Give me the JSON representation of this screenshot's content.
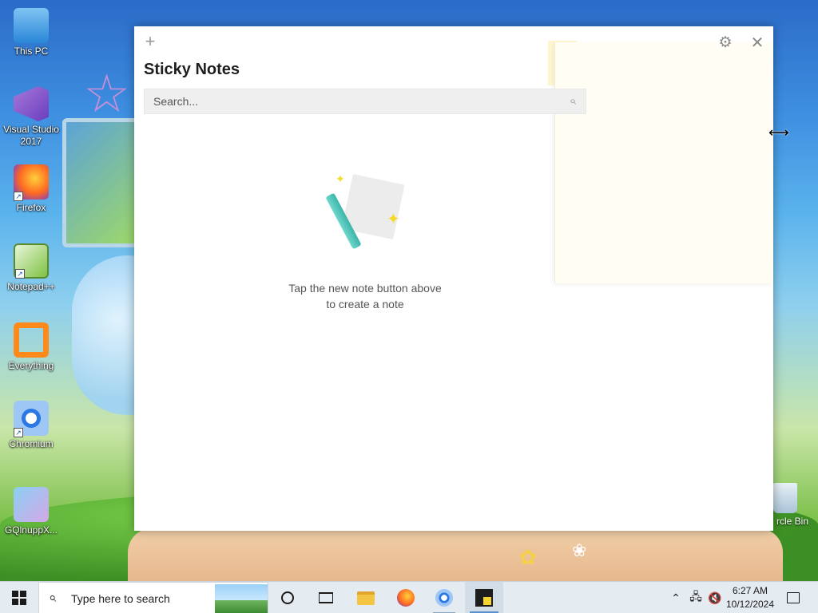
{
  "desktop": {
    "icons": [
      {
        "label": "This PC"
      },
      {
        "label": "Visual Studio 2017"
      },
      {
        "label": "Firefox"
      },
      {
        "label": "Notepad++"
      },
      {
        "label": "Everything"
      },
      {
        "label": "Chromium"
      },
      {
        "label": "GQlnuppX..."
      }
    ],
    "recycle_bin_label": "rcle Bin"
  },
  "sticky_notes": {
    "title": "Sticky Notes",
    "new_note_icon": "plus-icon",
    "settings_icon": "gear-icon",
    "close_icon": "close-icon",
    "search": {
      "placeholder": "Search...",
      "value": "",
      "icon": "search-icon"
    },
    "empty_state": {
      "line1": "Tap the new note button above",
      "line2": "to create a note"
    }
  },
  "taskbar": {
    "search_placeholder": "Type here to search",
    "pinned_apps": [
      "cortana-icon",
      "task-view-icon",
      "file-explorer-icon",
      "firefox-icon",
      "chromium-icon",
      "sticky-notes-icon"
    ],
    "tray": {
      "time": "6:27 AM",
      "date": "10/12/2024"
    }
  },
  "colors": {
    "taskbar_bg": "#e4ebf1",
    "search_box_bg": "#efefef",
    "sticky_yellow": "#f7d330"
  }
}
